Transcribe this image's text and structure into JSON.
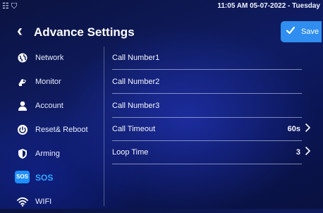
{
  "status_bar": {
    "icons": [
      "network-icon",
      "shield-icon"
    ],
    "datetime": "11:05 AM 05-07-2022 - Tuesday"
  },
  "header": {
    "title": "Advance Settings",
    "save_label": "Save"
  },
  "sidebar": {
    "items": [
      {
        "label": "Network",
        "icon": "network-globe-icon"
      },
      {
        "label": "Monitor",
        "icon": "monitor-camera-icon"
      },
      {
        "label": "Account",
        "icon": "account-user-icon"
      },
      {
        "label": "Reset& Reboot",
        "icon": "reset-reboot-icon"
      },
      {
        "label": "Arming",
        "icon": "arming-shield-icon"
      },
      {
        "label": "SOS",
        "icon": "sos-icon",
        "badge": "SOS",
        "active": true
      },
      {
        "label": "WIFI",
        "icon": "wifi-icon"
      }
    ]
  },
  "settings": {
    "rows": [
      {
        "label": "Call Number1",
        "value": ""
      },
      {
        "label": "Call Number2",
        "value": ""
      },
      {
        "label": "Call Number3",
        "value": ""
      },
      {
        "label": "Call Timeout",
        "value": "60s"
      },
      {
        "label": "Loop Time",
        "value": "3"
      }
    ]
  },
  "colors": {
    "accent": "#2ea8ff",
    "save_button": "#2f8ef0",
    "background": "#0f1c63"
  }
}
